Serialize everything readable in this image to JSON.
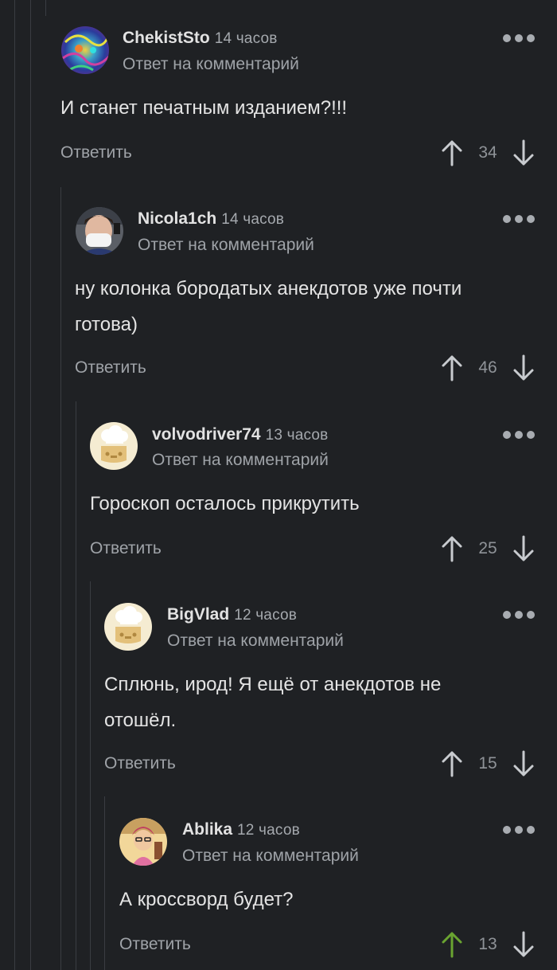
{
  "colors": {
    "background": "#1f2124",
    "thread_line": "#3a3d42",
    "upvote_active": "#6aa431",
    "text": "#e4e4e4",
    "muted": "#9fa3a8"
  },
  "comments": [
    {
      "author": "ChekistSto",
      "time": "14 часов",
      "reply_label": "Ответ на комментарий",
      "text": "И станет печатным изданием?!!!",
      "reply_button": "Ответить",
      "score": "34",
      "upvoted": false,
      "avatar_icon": "psychedelic-avatar-icon"
    },
    {
      "author": "Nicola1ch",
      "time": "14 часов",
      "reply_label": "Ответ на комментарий",
      "text_lines": [
        "ну колонка бородатых анекдотов уже почти",
        "готова)"
      ],
      "reply_button": "Ответить",
      "score": "46",
      "upvoted": false,
      "avatar_icon": "person-photo-avatar-icon"
    },
    {
      "author": "volvodriver74",
      "time": "13 часов",
      "reply_label": "Ответ на комментарий",
      "text": "Гороскоп осталось прикрутить",
      "reply_button": "Ответить",
      "score": "25",
      "upvoted": false,
      "avatar_icon": "default-chef-avatar-icon"
    },
    {
      "author": "BigVlad",
      "time": "12 часов",
      "reply_label": "Ответ на комментарий",
      "text_lines": [
        "Сплюнь, ирод! Я ещё от анекдотов не",
        "отошёл."
      ],
      "reply_button": "Ответить",
      "score": "15",
      "upvoted": false,
      "avatar_icon": "default-chef-avatar-icon"
    },
    {
      "author": "Ablika",
      "time": "12 часов",
      "reply_label": "Ответ на комментарий",
      "text": "А кроссворд будет?",
      "reply_button": "Ответить",
      "score": "13",
      "upvoted": true,
      "avatar_icon": "cartoon-avatar-icon"
    }
  ]
}
